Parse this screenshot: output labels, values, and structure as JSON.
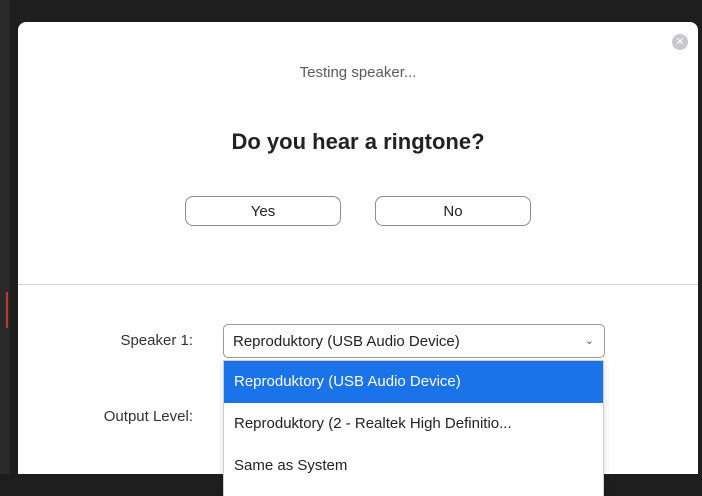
{
  "dialog": {
    "status_text": "Testing speaker...",
    "question": "Do you hear a ringtone?",
    "yes_label": "Yes",
    "no_label": "No",
    "close_icon": "close-icon"
  },
  "settings": {
    "speaker_label": "Speaker 1:",
    "speaker_value": "Reproduktory (USB Audio Device)",
    "output_label": "Output Level:"
  },
  "dropdown": {
    "options": [
      {
        "label": "Reproduktory (USB Audio Device)",
        "selected": true
      },
      {
        "label": "Reproduktory (2 - Realtek High Definitio...",
        "selected": false
      },
      {
        "label": "Same as System",
        "selected": false
      }
    ]
  },
  "colors": {
    "selected_bg": "#1a73e8"
  }
}
